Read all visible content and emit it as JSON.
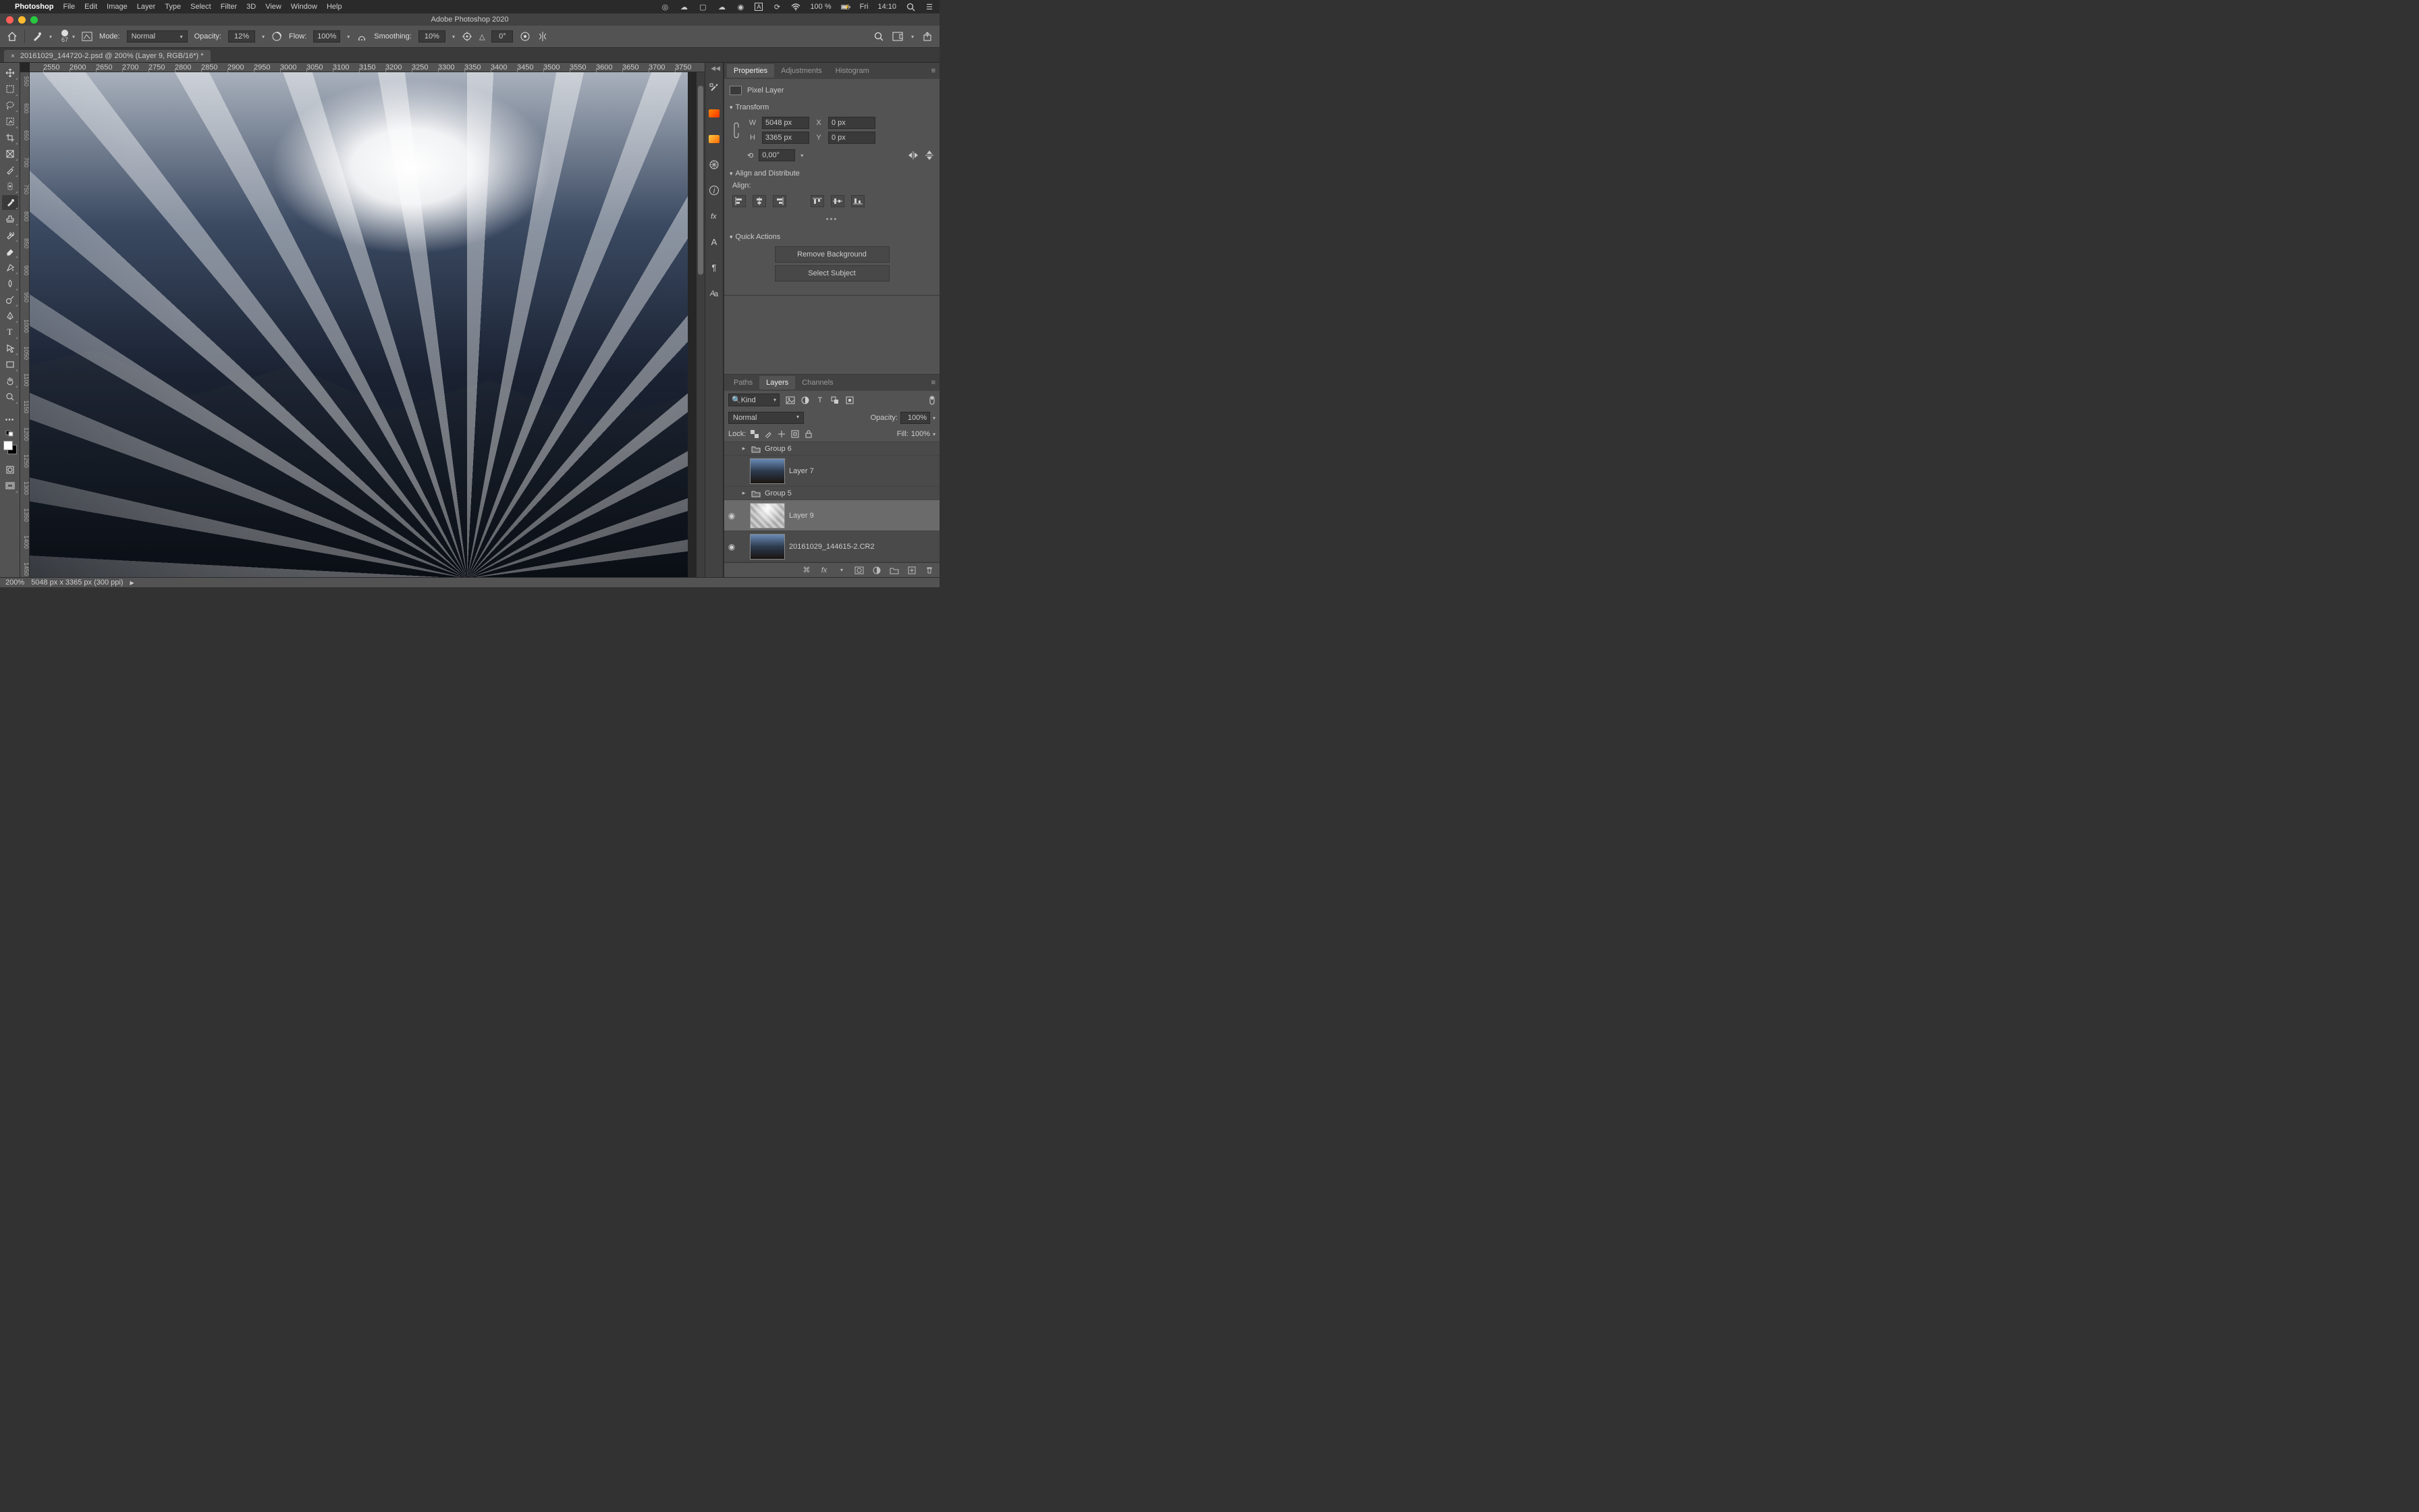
{
  "menubar": {
    "apple": "",
    "app": "Photoshop",
    "items": [
      "File",
      "Edit",
      "Image",
      "Layer",
      "Type",
      "Select",
      "Filter",
      "3D",
      "View",
      "Window",
      "Help"
    ],
    "status_percent": "100 %",
    "battery_icon": "⚡︎",
    "day": "Fri",
    "time": "14:10"
  },
  "window": {
    "title": "Adobe Photoshop 2020"
  },
  "optbar": {
    "brush_size": "67",
    "mode_label": "Mode:",
    "mode_value": "Normal",
    "opacity_label": "Opacity:",
    "opacity_value": "12%",
    "flow_label": "Flow:",
    "flow_value": "100%",
    "smoothing_label": "Smoothing:",
    "smoothing_value": "10%",
    "angle_label": "△",
    "angle_value": "0°"
  },
  "doc": {
    "tab": "20161029_144720-2.psd @ 200% (Layer 9, RGB/16*) *"
  },
  "ruler_h": [
    "2550",
    "2600",
    "2650",
    "2700",
    "2750",
    "2800",
    "2850",
    "2900",
    "2950",
    "3000",
    "3050",
    "3100",
    "3150",
    "3200",
    "3250",
    "3300",
    "3350",
    "3400",
    "3450",
    "3500",
    "3550",
    "3600",
    "3650",
    "3700",
    "3750"
  ],
  "ruler_v": [
    "550",
    "600",
    "650",
    "700",
    "750",
    "800",
    "850",
    "900",
    "950",
    "1000",
    "1050",
    "1100",
    "1150",
    "1200",
    "1250",
    "1300",
    "1350",
    "1400",
    "1450"
  ],
  "panels": {
    "tabs1": [
      "Properties",
      "Adjustments",
      "Histogram"
    ],
    "pixel_layer": "Pixel Layer",
    "transform_hd": "Transform",
    "W": "W",
    "H": "H",
    "X": "X",
    "Y": "Y",
    "w_val": "5048 px",
    "h_val": "3365 px",
    "x_val": "0 px",
    "y_val": "0 px",
    "angle": "0,00°",
    "align_hd": "Align and Distribute",
    "align_lbl": "Align:",
    "quick_hd": "Quick Actions",
    "qa1": "Remove Background",
    "qa2": "Select Subject",
    "tabs2": [
      "Paths",
      "Layers",
      "Channels"
    ],
    "kind": "Kind",
    "blend": "Normal",
    "opacity_lbl": "Opacity:",
    "opacity_val": "100%",
    "lock_lbl": "Lock:",
    "fill_lbl": "Fill:",
    "fill_val": "100%",
    "layers": [
      {
        "eye": "",
        "kind": "group",
        "name": "Group 6"
      },
      {
        "eye": "",
        "kind": "pixel",
        "name": "Layer 7",
        "thumb": "photo"
      },
      {
        "eye": "",
        "kind": "group",
        "name": "Group 5"
      },
      {
        "eye": "◉",
        "kind": "pixel",
        "name": "Layer 9",
        "thumb": "rays",
        "selected": true
      },
      {
        "eye": "◉",
        "kind": "pixel",
        "name": "20161029_144615-2.CR2",
        "thumb": "photo"
      }
    ]
  },
  "status": {
    "zoom": "200%",
    "dims": "5048 px x 3365 px (300 ppi)"
  }
}
